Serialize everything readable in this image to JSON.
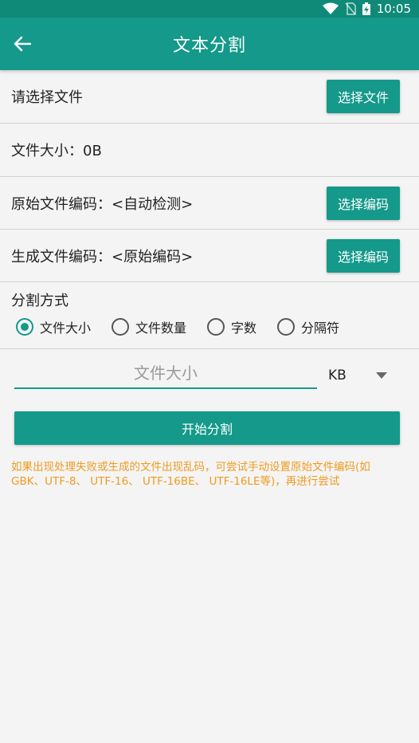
{
  "status_bar": {
    "time": "10:05"
  },
  "header": {
    "title": "文本分割"
  },
  "file_select": {
    "label": "请选择文件",
    "button": "选择文件"
  },
  "file_size": {
    "label": "文件大小：0B"
  },
  "source_encoding": {
    "label": "原始文件编码：<自动检测>",
    "button": "选择编码"
  },
  "output_encoding": {
    "label": "生成文件编码：<原始编码>",
    "button": "选择编码"
  },
  "split_mode": {
    "label": "分割方式",
    "options": [
      {
        "label": "文件大小",
        "checked": true
      },
      {
        "label": "文件数量",
        "checked": false
      },
      {
        "label": "字数",
        "checked": false
      },
      {
        "label": "分隔符",
        "checked": false
      }
    ]
  },
  "size_input": {
    "placeholder": "文件大小",
    "value": ""
  },
  "unit": {
    "selected": "KB"
  },
  "start_button": "开始分割",
  "hint": "如果出现处理失败或生成的文件出现乱码，可尝试手动设置原始文件编码(如GBK、UTF-8、 UTF-16、 UTF-16BE、 UTF-16LE等)，再进行尝试",
  "colors": {
    "primary": "#14998a",
    "status_bar": "#0f8a78",
    "hint": "#ef9b21"
  }
}
